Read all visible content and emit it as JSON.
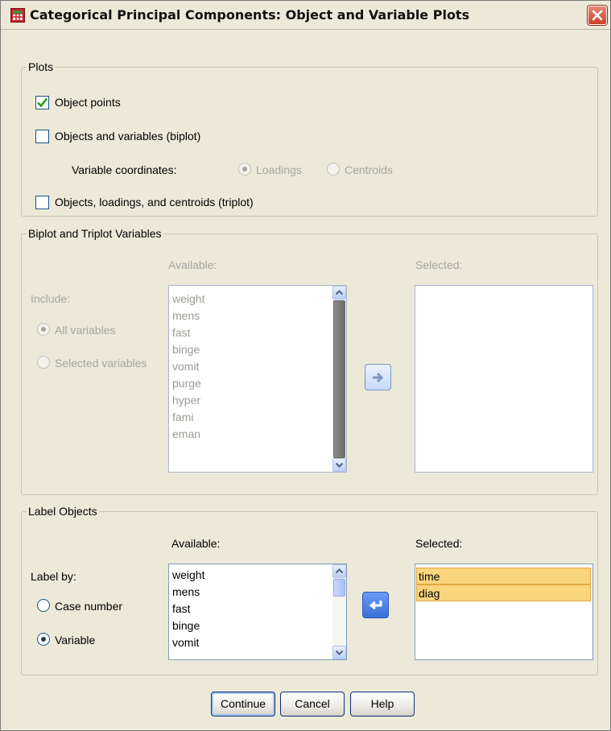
{
  "window": {
    "title": "Categorical Principal Components: Object and Variable Plots",
    "close_label": "×"
  },
  "plots": {
    "legend": "Plots",
    "object_points": {
      "label": "Object points",
      "checked": true
    },
    "biplot": {
      "label": "Objects and variables (biplot)",
      "checked": false
    },
    "variable_coordinates_label": "Variable coordinates:",
    "loadings_label": "Loadings",
    "centroids_label": "Centroids",
    "triplot": {
      "label": "Objects, loadings, and centroids (triplot)",
      "checked": false
    }
  },
  "biplot_vars": {
    "legend": "Biplot and Triplot Variables",
    "available_label": "Available:",
    "selected_label": "Selected:",
    "include_label": "Include:",
    "all_variables_label": "All variables",
    "selected_variables_label": "Selected variables",
    "available_items": [
      "weight",
      "mens",
      "fast",
      "binge",
      "vomit",
      "purge",
      "hyper",
      "fami",
      "eman"
    ],
    "selected_items": []
  },
  "label_objects": {
    "legend": "Label Objects",
    "available_label": "Available:",
    "selected_label": "Selected:",
    "label_by": "Label by:",
    "case_number_label": "Case number",
    "variable_label": "Variable",
    "available_items": [
      "weight",
      "mens",
      "fast",
      "binge",
      "vomit"
    ],
    "selected_items": [
      "time",
      "diag"
    ]
  },
  "buttons": {
    "continue": "Continue",
    "cancel": "Cancel",
    "help": "Help"
  },
  "colors": {
    "dialog_bg": "#ece9d8",
    "selected_highlight": "#fbd57e",
    "disabled_text": "#a7a6a0"
  }
}
